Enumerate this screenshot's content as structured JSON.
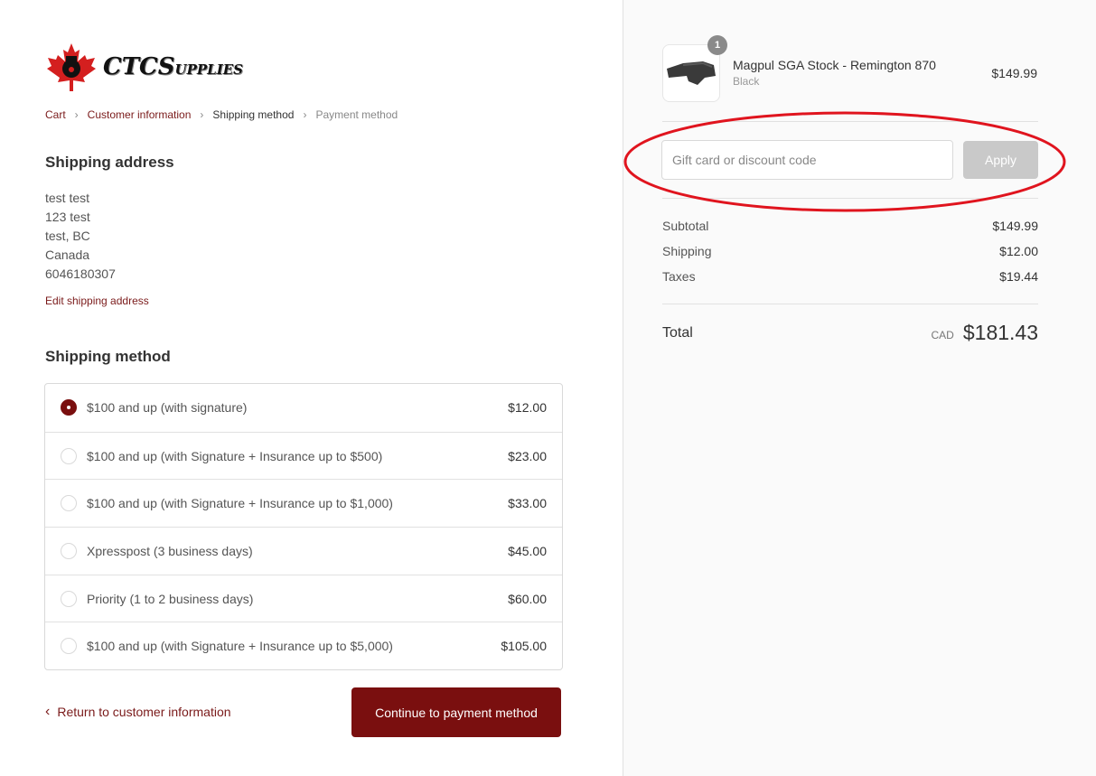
{
  "logo": {
    "text_big": "CTCS",
    "text_small": "UPPLIES"
  },
  "breadcrumb": {
    "items": [
      {
        "label": "Cart"
      },
      {
        "label": "Customer information"
      },
      {
        "label": "Shipping method"
      },
      {
        "label": "Payment method"
      }
    ]
  },
  "shipping_address": {
    "title": "Shipping address",
    "lines": [
      "test test",
      "123 test",
      "test, BC",
      "Canada",
      "6046180307"
    ],
    "edit_label": "Edit shipping address"
  },
  "shipping_method": {
    "title": "Shipping method",
    "selected_index": 0,
    "options": [
      {
        "label": "$100 and up (with signature)",
        "price": "$12.00"
      },
      {
        "label": "$100 and up (with Signature + Insurance up to $500)",
        "price": "$23.00"
      },
      {
        "label": "$100 and up (with Signature + Insurance up to $1,000)",
        "price": "$33.00"
      },
      {
        "label": "Xpresspost (3 business days)",
        "price": "$45.00"
      },
      {
        "label": "Priority (1 to 2 business days)",
        "price": "$60.00"
      },
      {
        "label": "$100 and up (with Signature + Insurance up to $5,000)",
        "price": "$105.00"
      }
    ]
  },
  "actions": {
    "return_label": "Return to customer information",
    "continue_label": "Continue to payment method"
  },
  "order": {
    "product": {
      "name": "Magpul SGA Stock - Remington 870",
      "variant": "Black",
      "price": "$149.99",
      "quantity": "1"
    },
    "discount": {
      "placeholder": "Gift card or discount code",
      "value": "",
      "apply_label": "Apply"
    },
    "summary": {
      "subtotal_label": "Subtotal",
      "subtotal": "$149.99",
      "shipping_label": "Shipping",
      "shipping": "$12.00",
      "taxes_label": "Taxes",
      "taxes": "$19.44"
    },
    "total": {
      "label": "Total",
      "currency": "CAD",
      "value": "$181.43"
    }
  },
  "colors": {
    "accent": "#7a0f0f",
    "annotation": "#e0141e",
    "sidebar_bg": "#fafafa"
  }
}
